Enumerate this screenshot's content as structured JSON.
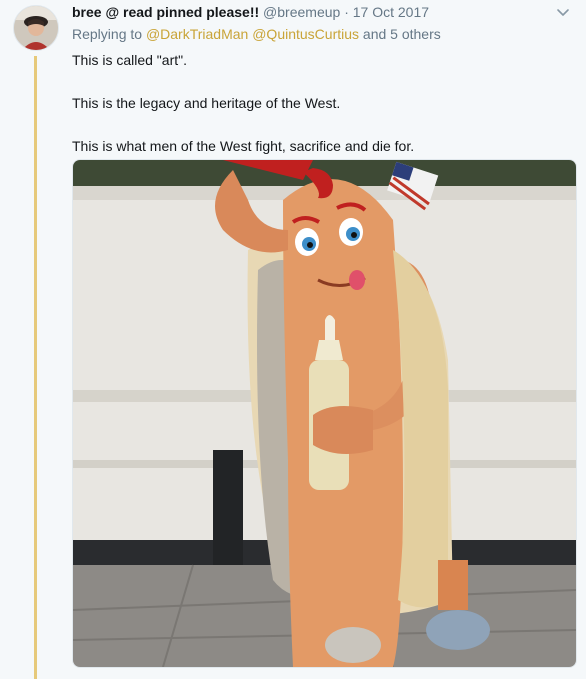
{
  "tweet": {
    "display_name": "bree @ read pinned please!!",
    "handle": "@breemeup",
    "separator": "·",
    "date": "17 Oct 2017",
    "reply_prefix": "Replying to",
    "reply_mentions": [
      "@DarkTriadMan",
      "@QuintusCurtius"
    ],
    "reply_suffix": "and 5 others",
    "paragraphs": [
      "This is called \"art\".",
      "This is the legacy and heritage of the West.",
      "This is what men of the West fight, sacrifice and die for."
    ]
  },
  "icons": {
    "menu": "chevron-down-icon",
    "avatar": "avatar-photo"
  },
  "media": {
    "description_icon": "hot-dog-statue-photo"
  },
  "colors": {
    "background": "#f5f8fa",
    "thread_line": "#e6c97a",
    "mention": "#c9a438",
    "secondary_text": "#657786"
  }
}
